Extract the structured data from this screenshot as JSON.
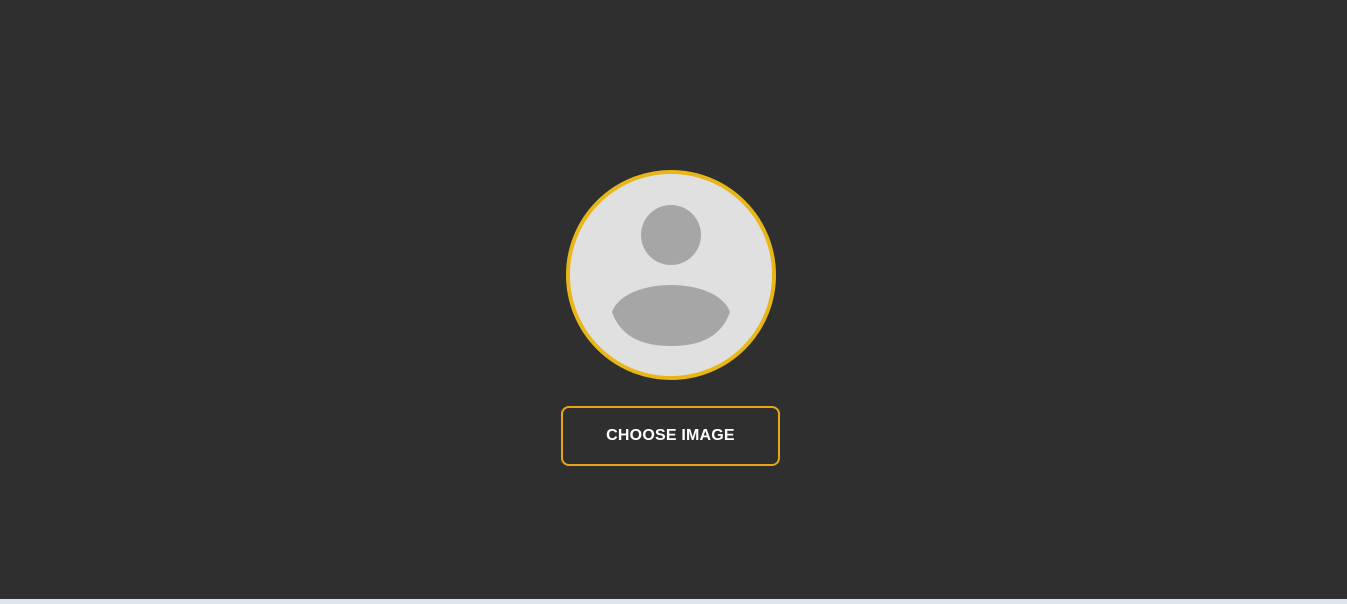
{
  "avatar": {
    "icon": "default-user-avatar-icon",
    "ring_color": "#e8b717",
    "fill_color": "#e0e0e0",
    "figure_color": "#a6a6a6"
  },
  "actions": {
    "choose_image_label": "CHOOSE IMAGE",
    "button_border_color": "#e8a617"
  },
  "theme": {
    "background": "#2f2f2f"
  }
}
